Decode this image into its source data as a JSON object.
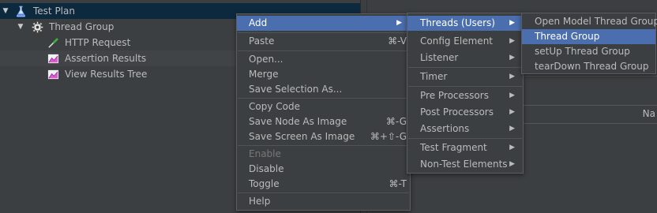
{
  "tree": {
    "items": [
      {
        "label": "Test Plan",
        "icon": "flask-icon"
      },
      {
        "label": "Thread Group",
        "icon": "gear-icon"
      },
      {
        "label": "HTTP Request",
        "icon": "pipette-icon"
      },
      {
        "label": "Assertion Results",
        "icon": "chart-icon"
      },
      {
        "label": "View Results Tree",
        "icon": "chart-icon"
      }
    ]
  },
  "right_panel": {
    "column_label": "Na"
  },
  "context_menu": {
    "add": "Add",
    "paste": "Paste",
    "paste_shortcut": "⌘-V",
    "open": "Open...",
    "merge": "Merge",
    "save_selection_as": "Save Selection As...",
    "copy_code": "Copy Code",
    "save_node_as_image": "Save Node As Image",
    "save_node_as_image_shortcut": "⌘-G",
    "save_screen_as_image": "Save Screen As Image",
    "save_screen_as_image_shortcut": "⌘+⇧-G",
    "enable": "Enable",
    "disable": "Disable",
    "toggle": "Toggle",
    "toggle_shortcut": "⌘-T",
    "help": "Help"
  },
  "add_submenu": {
    "threads_users": "Threads (Users)",
    "config_element": "Config Element",
    "listener": "Listener",
    "timer": "Timer",
    "pre_processors": "Pre Processors",
    "post_processors": "Post Processors",
    "assertions": "Assertions",
    "test_fragment": "Test Fragment",
    "non_test_elements": "Non-Test Elements"
  },
  "threads_submenu": {
    "open_model_thread_group": "Open Model Thread Group",
    "thread_group": "Thread Group",
    "setup_thread_group": "setUp Thread Group",
    "teardown_thread_group": "tearDown Thread Group"
  },
  "colors": {
    "background": "#3c3f41",
    "selection": "#4b6eaf",
    "tree_selection": "#0d293e",
    "text": "#bbbbbb"
  }
}
